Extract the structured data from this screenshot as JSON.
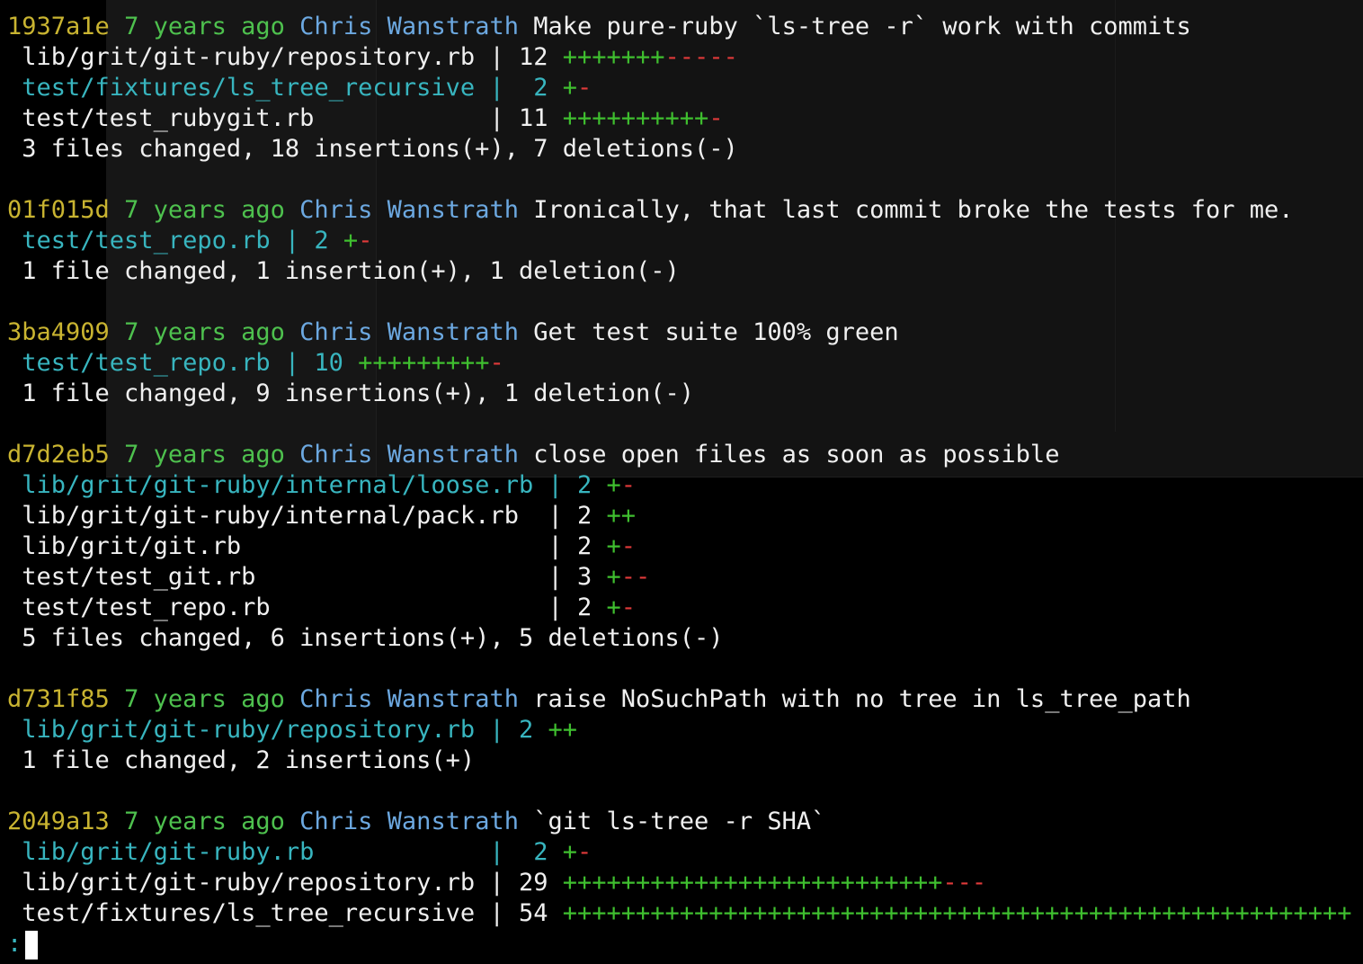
{
  "commits": [
    {
      "hash": "1937a1e",
      "date": "7 years ago",
      "author": "Chris Wanstrath",
      "message": "Make pure-ruby `ls-tree -r` work with commits",
      "files": [
        {
          "path": "lib/grit/git-ruby/repository.rb",
          "highlight": false,
          "sep": " | ",
          "count": "12",
          "plus": "+++++++",
          "minus": "-----"
        },
        {
          "path": "test/fixtures/ls_tree_recursive",
          "highlight": true,
          "sep": " |  ",
          "count": "2",
          "plus": "+",
          "minus": "-"
        },
        {
          "path": "test/test_rubygit.rb           ",
          "highlight": false,
          "sep": " | ",
          "count": "11",
          "plus": "++++++++++",
          "minus": "-"
        }
      ],
      "summary": "3 files changed, 18 insertions(+), 7 deletions(-)"
    },
    {
      "hash": "01f015d",
      "date": "7 years ago",
      "author": "Chris Wanstrath",
      "message": "Ironically, that last commit broke the tests for me.",
      "files": [
        {
          "path": "test/test_repo.rb",
          "highlight": true,
          "sep": " | ",
          "count": "2",
          "plus": "+",
          "minus": "-"
        }
      ],
      "summary": "1 file changed, 1 insertion(+), 1 deletion(-)"
    },
    {
      "hash": "3ba4909",
      "date": "7 years ago",
      "author": "Chris Wanstrath",
      "message": "Get test suite 100% green",
      "files": [
        {
          "path": "test/test_repo.rb",
          "highlight": true,
          "sep": " | ",
          "count": "10",
          "plus": "+++++++++",
          "minus": "-"
        }
      ],
      "summary": "1 file changed, 9 insertions(+), 1 deletion(-)"
    },
    {
      "hash": "d7d2eb5",
      "date": "7 years ago",
      "author": "Chris Wanstrath",
      "message": "close open files as soon as possible",
      "files": [
        {
          "path": "lib/grit/git-ruby/internal/loose.rb",
          "highlight": true,
          "sep": " | ",
          "count": "2",
          "plus": "+",
          "minus": "-"
        },
        {
          "path": "lib/grit/git-ruby/internal/pack.rb ",
          "highlight": false,
          "sep": " | ",
          "count": "2",
          "plus": "++",
          "minus": ""
        },
        {
          "path": "lib/grit/git.rb                    ",
          "highlight": false,
          "sep": " | ",
          "count": "2",
          "plus": "+",
          "minus": "-"
        },
        {
          "path": "test/test_git.rb                   ",
          "highlight": false,
          "sep": " | ",
          "count": "3",
          "plus": "+",
          "minus": "--"
        },
        {
          "path": "test/test_repo.rb                  ",
          "highlight": false,
          "sep": " | ",
          "count": "2",
          "plus": "+",
          "minus": "-"
        }
      ],
      "summary": "5 files changed, 6 insertions(+), 5 deletions(-)"
    },
    {
      "hash": "d731f85",
      "date": "7 years ago",
      "author": "Chris Wanstrath",
      "message": "raise NoSuchPath with no tree in ls_tree_path",
      "files": [
        {
          "path": "lib/grit/git-ruby/repository.rb",
          "highlight": true,
          "sep": " | ",
          "count": "2",
          "plus": "++",
          "minus": ""
        }
      ],
      "summary": "1 file changed, 2 insertions(+)"
    },
    {
      "hash": "2049a13",
      "date": "7 years ago",
      "author": "Chris Wanstrath",
      "message": "`git ls-tree -r SHA`",
      "files": [
        {
          "path": "lib/grit/git-ruby.rb           ",
          "highlight": true,
          "sep": " |  ",
          "count": "2",
          "plus": "+",
          "minus": "-"
        },
        {
          "path": "lib/grit/git-ruby/repository.rb",
          "highlight": false,
          "sep": " | ",
          "count": "29",
          "plus": "++++++++++++++++++++++++++",
          "minus": "---"
        },
        {
          "path": "test/fixtures/ls_tree_recursive",
          "highlight": false,
          "sep": " | ",
          "count": "54",
          "plus": "++++++++++++++++++++++++++++++++++++++++++++++++++++++",
          "minus": ""
        }
      ],
      "summary": null
    }
  ],
  "prompt": ":",
  "colors": {
    "hash": "#c9b431",
    "date": "#4ec14e",
    "author": "#6ca8e0",
    "path_highlight": "#38b5bf",
    "plus": "#3fbf2f",
    "minus": "#e03a3a",
    "background": "#000000"
  }
}
